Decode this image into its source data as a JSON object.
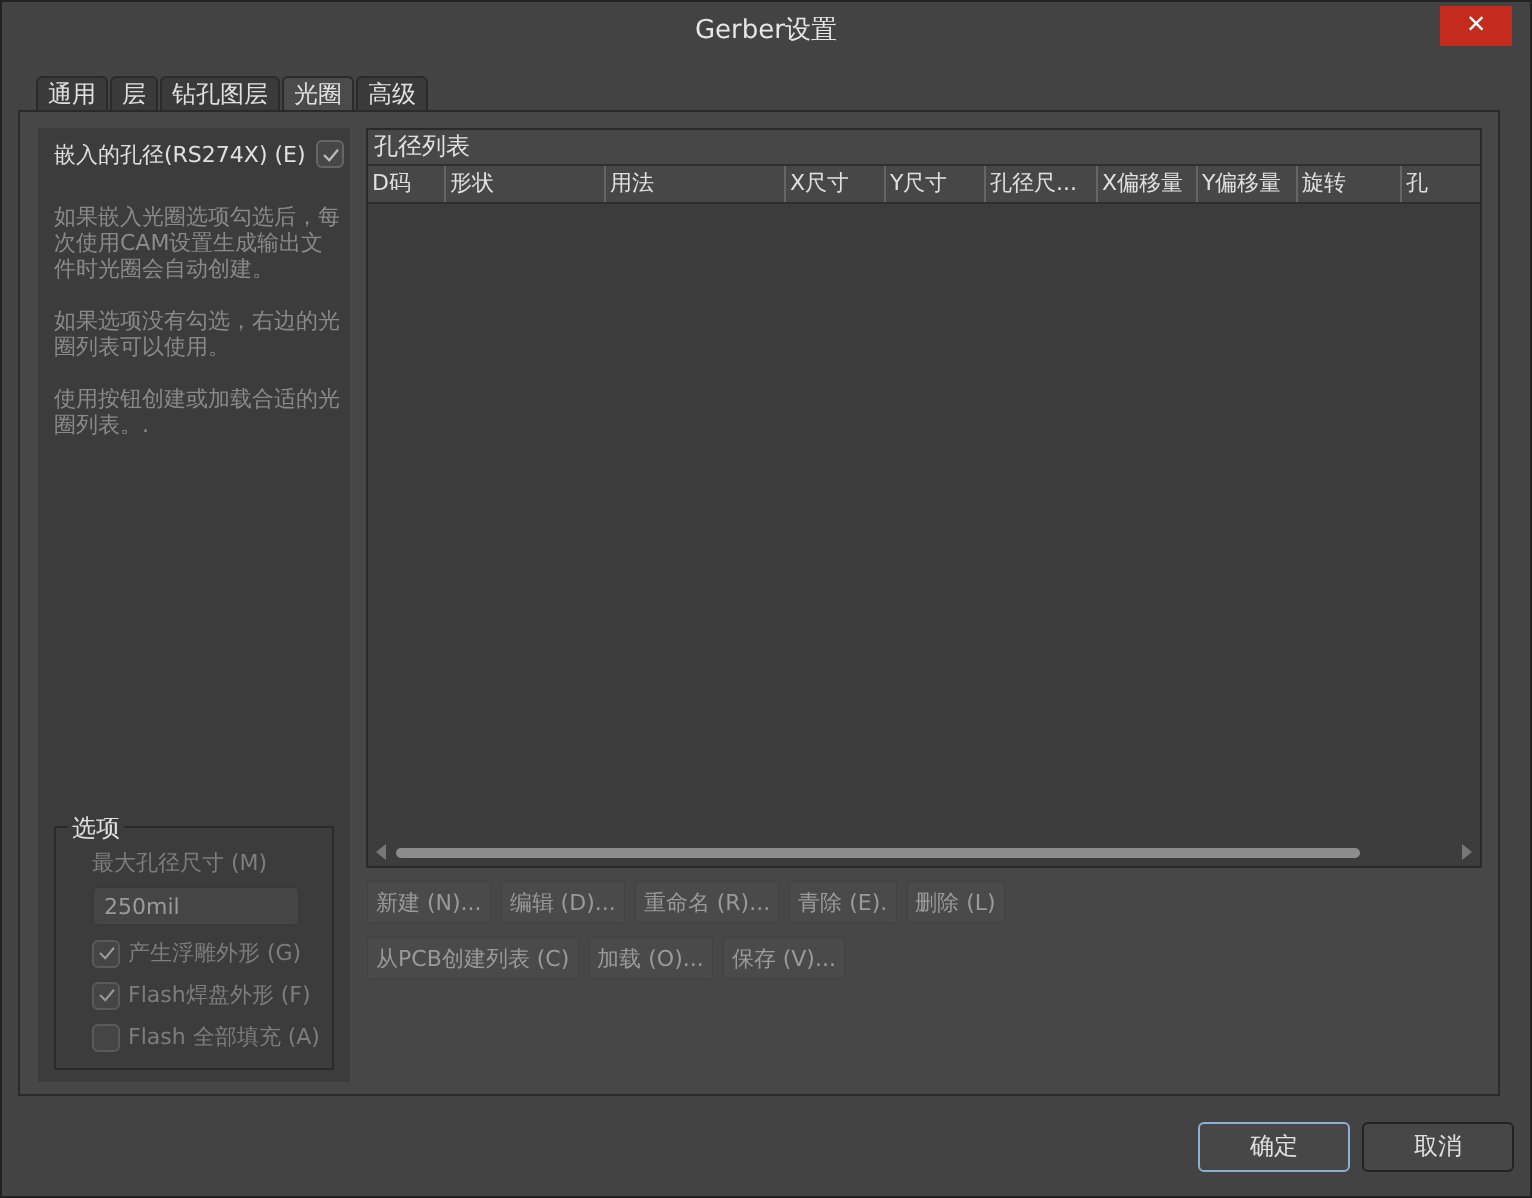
{
  "window": {
    "title": "Gerber设置",
    "close": "×"
  },
  "tabs": [
    {
      "label": "通用",
      "selected": false
    },
    {
      "label": "层",
      "selected": false
    },
    {
      "label": "钻孔图层",
      "selected": false
    },
    {
      "label": "光圈",
      "selected": true
    },
    {
      "label": "高级",
      "selected": false
    }
  ],
  "embedded": {
    "label": "嵌入的孔径(RS274X) (E)",
    "checked": true
  },
  "description": [
    "如果嵌入光圈选项勾选后，每次使用CAM设置生成输出文件时光圈会自动创建。",
    "如果选项没有勾选，右边的光圈列表可以使用。",
    "使用按钮创建或加载合适的光圈列表。."
  ],
  "options": {
    "title": "选项",
    "disabled": true,
    "max_size_label": "最大孔径尺寸 (M)",
    "max_size_value": "250mil",
    "checkboxes": [
      {
        "label": "产生浮雕外形 (G)",
        "checked": true
      },
      {
        "label": "Flash焊盘外形 (F)",
        "checked": true
      },
      {
        "label": "Flash 全部填充 (A)",
        "checked": false
      }
    ]
  },
  "aperture_list": {
    "title": "孔径列表",
    "columns": [
      "D码",
      "形状",
      "用法",
      "X尺寸",
      "Y尺寸",
      "孔径尺...",
      "X偏移量",
      "Y偏移量",
      "旋转",
      "孔"
    ]
  },
  "list_buttons": [
    [
      "新建 (N)...",
      "编辑 (D)...",
      "重命名 (R)...",
      "青除 (E).",
      "删除 (L)"
    ],
    [
      "从PCB创建列表 (C)",
      "加载 (O)...",
      "保存 (V)..."
    ]
  ],
  "footer_buttons": [
    {
      "label": "确定",
      "selected": true
    },
    {
      "label": "取消",
      "selected": false
    }
  ]
}
